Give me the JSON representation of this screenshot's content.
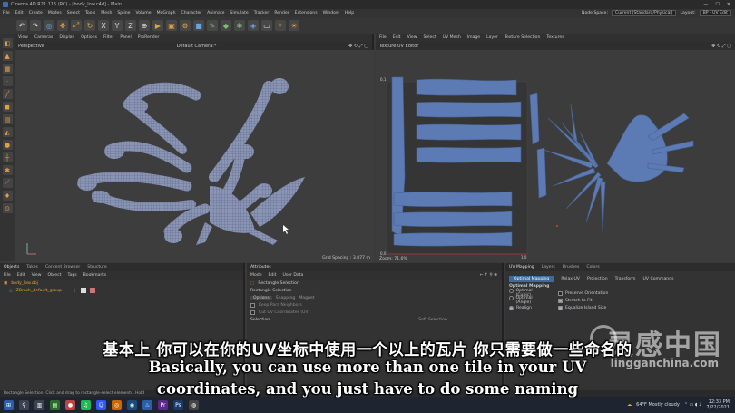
{
  "window": {
    "title": "Cinema 4D R21.115 (RC) - [body_low.c4d] - Main",
    "controls": [
      "—",
      "☐",
      "✕"
    ]
  },
  "menubar": {
    "items": [
      "File",
      "Edit",
      "Create",
      "Modes",
      "Select",
      "Tools",
      "Mesh",
      "Spline",
      "Volume",
      "MoGraph",
      "Character",
      "Animate",
      "Simulate",
      "Tracker",
      "Render",
      "Extensions",
      "Window",
      "Help"
    ],
    "node_space_label": "Node Space:",
    "node_space_value": "Current (Standard/Physical)",
    "layout_label": "Layout:",
    "layout_value": "BP - UV Edit"
  },
  "viewport": {
    "menu": [
      "View",
      "Cameras",
      "Display",
      "Options",
      "Filter",
      "Panel",
      "ProRender"
    ],
    "name": "Perspective",
    "camera": "Default Camera:*",
    "grid_spacing": "Grid Spacing : 3.877 m"
  },
  "uv_editor": {
    "menu": [
      "File",
      "Edit",
      "View",
      "Select",
      "UV Mesh",
      "Image",
      "Layer",
      "Texture Selection",
      "Textures"
    ],
    "title": "Texture UV Editor",
    "tick_top_left": "0,1",
    "tick_bottom_left": "0,0",
    "tick_bottom_right": "1,0",
    "zoom": "Zoom: 71.0%"
  },
  "objects_panel": {
    "tabs": [
      "Objects",
      "Takes",
      "Content Browser",
      "Structure"
    ],
    "menu": [
      "File",
      "Edit",
      "View",
      "Object",
      "Tags",
      "Bookmarks"
    ],
    "items": [
      "body_low.obj",
      "ZBrush_default_group"
    ]
  },
  "attributes_panel": {
    "tab": "Attributes",
    "menu": [
      "Mode",
      "Edit",
      "User Data"
    ],
    "title": "Rectangle Selection",
    "heading": "Rectangle Selection",
    "subtabs": [
      "Options",
      "Snapping",
      "Magnet"
    ],
    "options": [
      "Keep Para Neighbors",
      "Cut UV Coordinates (UV)"
    ],
    "section": "Selection",
    "soft_selection": "Soft Selection"
  },
  "uv_mapping": {
    "tabs": [
      "UV Mapping",
      "Layers",
      "Brushes",
      "Colors"
    ],
    "subtabs": [
      "Optimal Mapping",
      "Relax UV",
      "Projection",
      "Transform",
      "UV Commands"
    ],
    "section": "Optimal Mapping",
    "options": [
      {
        "label": "Optimal (Cubic)",
        "checked": false
      },
      {
        "label": "Preserve Orientation",
        "checked": false
      },
      {
        "label": "Optimal (Angle)",
        "checked": false
      },
      {
        "label": "Stretch to Fit",
        "checked": true
      },
      {
        "label": "Realign",
        "checked": true
      },
      {
        "label": "Equalize Island Size",
        "checked": true
      }
    ]
  },
  "status": {
    "text": "Rectangle Selection: Click and drag to rectangle-select elements. Hold"
  },
  "taskbar": {
    "weather": "64°F  Mostly cloudy",
    "time": "12:33 PM",
    "date": "7/22/2021"
  },
  "subtitles": {
    "zh": "基本上 你可以在你的UV坐标中使用一个以上的瓦片 你只需要做一些命名的",
    "en_line1": "Basically, you can use more than one tile in your UV",
    "en_line2": "coordinates, and you just have to do some naming"
  },
  "watermark": {
    "brand": "灵感中国",
    "url": "lingganchina.com"
  }
}
